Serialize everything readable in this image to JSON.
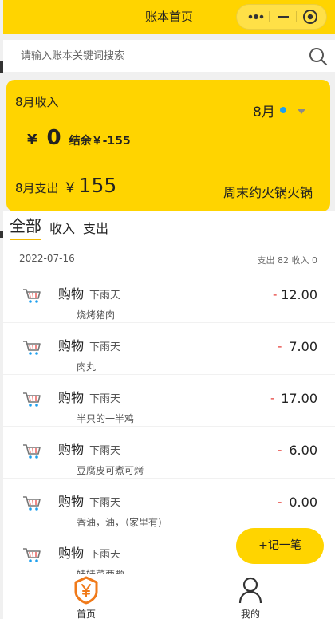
{
  "nav": {
    "title": "账本首页"
  },
  "capsule": {
    "more_icon": "more-dots-icon",
    "minimize_icon": "minimize-icon",
    "close_icon": "close-target-icon"
  },
  "search": {
    "placeholder": "请输入账本关键词搜索",
    "value": "",
    "icon": "search-icon"
  },
  "summary_card": {
    "income_label": "8月收入",
    "month": "8月",
    "currency": "¥",
    "income_value": "0",
    "balance": "结余￥-155",
    "expense_label": "8月支出",
    "expense_currency": "￥",
    "expense_value": "155",
    "note": "周末约火锅火锅"
  },
  "tabs": [
    {
      "label": "全部",
      "active": true
    },
    {
      "label": "收入",
      "active": false
    },
    {
      "label": "支出",
      "active": false
    }
  ],
  "day_group": {
    "date": "2022-07-16",
    "summary": "支出 82 收入 0"
  },
  "records": [
    {
      "category": "购物",
      "account": "下雨天",
      "remark": "烧烤猪肉",
      "sign": "-",
      "amount": "12.00",
      "icon": "shopping-cart-icon"
    },
    {
      "category": "购物",
      "account": "下雨天",
      "remark": "肉丸",
      "sign": "-",
      "amount": "7.00",
      "icon": "shopping-cart-icon"
    },
    {
      "category": "购物",
      "account": "下雨天",
      "remark": "半只的一半鸡",
      "sign": "-",
      "amount": "17.00",
      "icon": "shopping-cart-icon"
    },
    {
      "category": "购物",
      "account": "下雨天",
      "remark": "豆腐皮可煮可烤",
      "sign": "-",
      "amount": "6.00",
      "icon": "shopping-cart-icon"
    },
    {
      "category": "购物",
      "account": "下雨天",
      "remark": "香油，油，（家里有)",
      "sign": "-",
      "amount": "0.00",
      "icon": "shopping-cart-icon"
    },
    {
      "category": "购物",
      "account": "下雨天",
      "remark": "娃娃菜西颗",
      "sign": "-",
      "amount": "",
      "icon": "shopping-cart-icon"
    }
  ],
  "fab": {
    "label": "+记一笔"
  },
  "tabbar": [
    {
      "label": "首页",
      "icon": "home-yen-shield-icon",
      "color": "#f07a1a"
    },
    {
      "label": "我的",
      "icon": "user-icon"
    }
  ],
  "colors": {
    "brand": "#ffd400",
    "expense_sign": "#e53935",
    "month_dot": "#1ea0ee"
  }
}
